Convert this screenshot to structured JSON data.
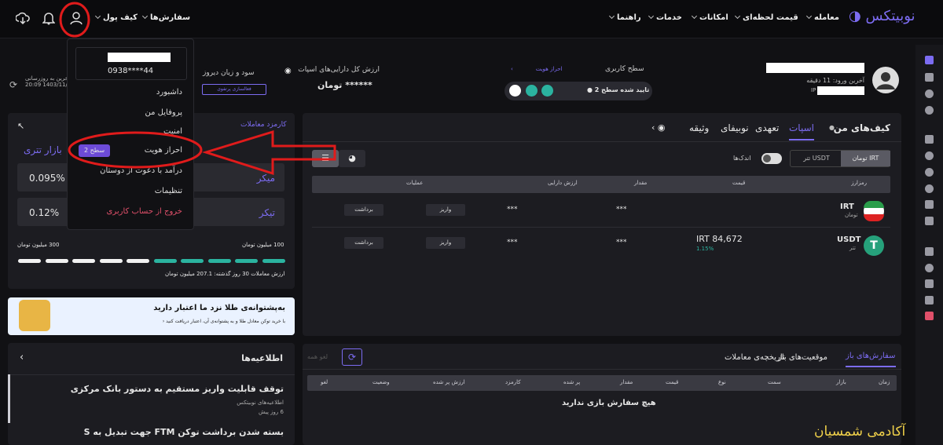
{
  "header": {
    "logo": "نوبیتکس",
    "nav": [
      "معامله",
      "قیمت لحظه‌ای",
      "امکانات",
      "خدمات",
      "راهنما"
    ],
    "orders_label": "سفارش‌ها",
    "wallet_label": "کیف پول"
  },
  "user": {
    "last_login": "آخرین ورود: 11 دقیقه پیش",
    "ip_label": "IP"
  },
  "level": {
    "title": "سطح کاربری",
    "verify_link": "احراز هویت",
    "status": "تایید شده سطح 2"
  },
  "assets": {
    "total_label": "ارزش کل دارایی‌های اسپات",
    "total_value": "******",
    "currency": "تومان"
  },
  "pnl": {
    "label": "سود و زیان دیروز",
    "activate": "فعالسازی پرتفوی"
  },
  "update": {
    "line1": "آخرین به روزرسانی",
    "line2": "20:09 1403/11/..."
  },
  "menu": {
    "phone": "0938****44",
    "items": [
      "داشبورد",
      "پروفایل من",
      "امنیت",
      "احراز هویت",
      "درآمد با دعوت از دوستان",
      "تنظیمات",
      "خروج از حساب کاربری"
    ],
    "badge": "سطح 2"
  },
  "fees": {
    "title": "کارمزد معاملات",
    "market_tabs": [
      "بازار تتری"
    ],
    "maker_label": "میکر",
    "taker_label": "تیکر",
    "maker": "0.095%",
    "taker": "0.12%",
    "range_low": "100 میلیون تومان",
    "range_high": "300 میلیون تومان",
    "volume": "ارزش معاملات 30 روز گذشته: 207.1 میلیون تومان"
  },
  "gold": {
    "title": "به‌پشتوانه‌ی طلا نزد ما اعتبار دارید",
    "desc": "با خرید توکن معادل طلا و به پشتوانه‌ی آن، اعتبار دریافت کنید"
  },
  "news": {
    "title": "اطلاعیه‌ها",
    "items": [
      {
        "title": "توقف قابلیت واریز مستقیم به دستور بانک مرکزی",
        "source": "اطلاعیه‌های نوبیتکس",
        "time": "6 روز پیش"
      },
      {
        "title": "بسته شدن برداشت توکن FTM جهت تبدیل به S",
        "source": "",
        "time": ""
      }
    ]
  },
  "wallets": {
    "title": "کیف‌های من",
    "tabs": [
      "اسپات",
      "تعهدی",
      "نوبیفای",
      "وثیقه"
    ],
    "currency_toggle": [
      "تومان IRT",
      "تتر USDT"
    ],
    "small_label": "اندک‌ها",
    "columns": [
      "رمزارز",
      "قیمت",
      "مقدار",
      "ارزش دارایی",
      "عملیات"
    ],
    "rows": [
      {
        "symbol": "IRT",
        "name": "تومان",
        "price": "",
        "change": "",
        "amount": "***",
        "value": "***",
        "deposit": "واریز",
        "withdraw": "برداشت"
      },
      {
        "symbol": "USDT",
        "name": "تتر",
        "price": "IRT 84,672",
        "change": "1.15%",
        "amount": "***",
        "value": "***",
        "deposit": "واریز",
        "withdraw": "برداشت"
      }
    ]
  },
  "orders": {
    "tabs": [
      "سفارش‌های باز",
      "موقعیت‌های باز",
      "تاریخچه‌ی معاملات"
    ],
    "cancel_all": "لغو همه",
    "columns": [
      "زمان",
      "بازار",
      "سمت",
      "نوع",
      "قیمت",
      "مقدار",
      "پر شده",
      "کارمزد",
      "ارزش پر شده",
      "وضعیت",
      "لغو"
    ],
    "empty": "هیچ سفارش بازی ندارید"
  },
  "watermark": "آکادمی شمسیان",
  "colors": {
    "accent": "#7c6cf2",
    "teal": "#2bb3a0",
    "red_annotation": "#e01b1b",
    "badge": "#6d4bd8"
  }
}
